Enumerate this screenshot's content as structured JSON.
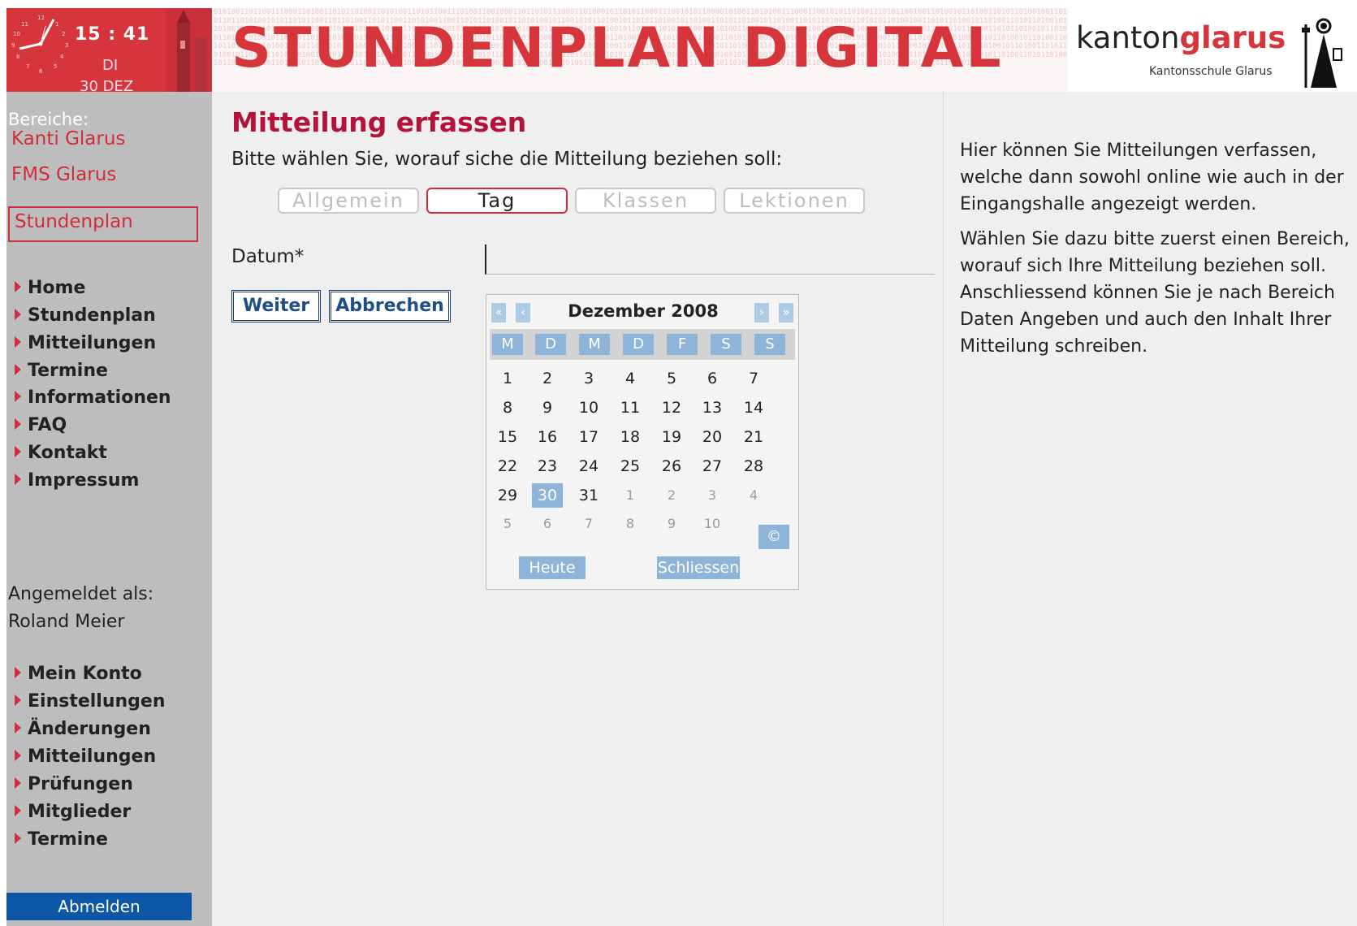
{
  "header": {
    "clock": {
      "time": "15 : 41",
      "day": "DI",
      "date": "30 DEZ"
    },
    "banner_title": "STUNDENPLAN DIGITAL",
    "logo": {
      "kanton": "kanton",
      "glarus": "glarus",
      "subtitle": "Kantonsschule Glarus"
    }
  },
  "sidebar": {
    "bereiche_title": "Bereiche:",
    "areas": [
      "Kanti Glarus",
      "FMS Glarus",
      "Stundenplan"
    ],
    "nav": [
      "Home",
      "Stundenplan",
      "Mitteilungen",
      "Termine",
      "Informationen",
      "FAQ",
      "Kontakt",
      "Impressum"
    ],
    "logged_in_label": "Angemeldet als:",
    "user_name": "Roland Meier",
    "user_nav": [
      "Mein Konto",
      "Einstellungen",
      "Änderungen",
      "Mitteilungen",
      "Prüfungen",
      "Mitglieder",
      "Termine"
    ],
    "logout": "Abmelden"
  },
  "main": {
    "title": "Mitteilung erfassen",
    "subtitle": "Bitte wählen Sie, worauf siche die Mitteilung beziehen soll:",
    "type_buttons": [
      "Allgemein",
      "Tag",
      "Klassen",
      "Lektionen"
    ],
    "active_type": "Tag",
    "datum_label": "Datum*",
    "datum_value": "",
    "weiter": "Weiter",
    "abbrechen": "Abbrechen"
  },
  "calendar": {
    "nav_prev_year": "«",
    "nav_prev_month": "‹",
    "nav_next_month": "›",
    "nav_next_year": "»",
    "title": "Dezember 2008",
    "weekdays": [
      "M",
      "D",
      "M",
      "D",
      "F",
      "S",
      "S"
    ],
    "weeks": [
      [
        "1",
        "2",
        "3",
        "4",
        "5",
        "6",
        "7"
      ],
      [
        "8",
        "9",
        "10",
        "11",
        "12",
        "13",
        "14"
      ],
      [
        "15",
        "16",
        "17",
        "18",
        "19",
        "20",
        "21"
      ],
      [
        "22",
        "23",
        "24",
        "25",
        "26",
        "27",
        "28"
      ],
      [
        "29",
        "30",
        "31",
        "1",
        "2",
        "3",
        "4"
      ],
      [
        "5",
        "6",
        "7",
        "8",
        "9",
        "10",
        ""
      ]
    ],
    "selected_day": "30",
    "today_icon": "©",
    "today_btn": "Heute",
    "close_btn": "Schliessen"
  },
  "info": {
    "p1": "Hier können Sie Mitteilungen verfassen, welche dann sowohl online wie auch in der Eingangshalle angezeigt werden.",
    "p2": "Wählen Sie dazu bitte zuerst einen Bereich, worauf sich Ihre Mitteilung beziehen soll. Anschliessend können Sie je nach Bereich Daten Angeben und auch den Inhalt Ihrer Mitteilung schreiben."
  },
  "colors": {
    "accent": "#cf2e3d",
    "calendar_blue": "#8fb4d9",
    "logout_blue": "#0d57a8"
  }
}
